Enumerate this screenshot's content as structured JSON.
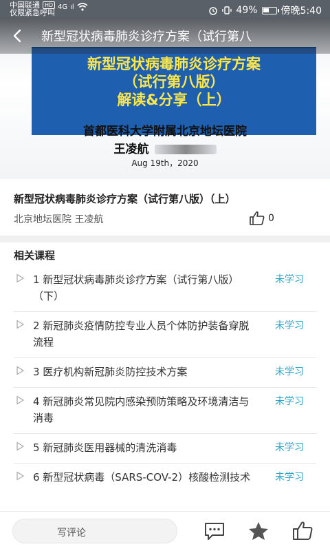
{
  "status_bar": {
    "carrier": "中国联通",
    "hd": "HD",
    "emergency": "仅限紧急呼叫",
    "network": "4G",
    "signal": "ıl",
    "battery_text": "49%",
    "battery_level": 0.49,
    "time": "傍晚5:40"
  },
  "video": {
    "title": "新型冠状病毒肺炎诊疗方案（试行第八",
    "slide_lines": [
      "新型冠状病毒肺炎诊疗方案",
      "（试行第八版）",
      "解读&分享（上）"
    ],
    "host": "首都医科大学附属北京地坛医院",
    "speaker": "王凌航",
    "date": "Aug 19th，2020"
  },
  "course": {
    "title": "新型冠状病毒肺炎诊疗方案（试行第八版）（上）",
    "author": "北京地坛医院 王凌航",
    "likes": "0"
  },
  "related": {
    "heading": "相关课程",
    "items": [
      {
        "text": "1 新型冠状病毒肺炎诊疗方案（试行第八版）（下）",
        "status": "未学习"
      },
      {
        "text": "2 新冠肺炎疫情防控专业人员个体防护装备穿脱流程",
        "status": "未学习"
      },
      {
        "text": "3 医疗机构新冠肺炎防控技术方案",
        "status": "未学习"
      },
      {
        "text": "4 新冠肺炎常见院内感染预防策略及环境清洁与消毒",
        "status": "未学习"
      },
      {
        "text": "5 新冠肺炎医用器械的清洗消毒",
        "status": "未学习"
      },
      {
        "text": "6 新型冠状病毒（SARS-COV-2）核酸检测技术",
        "status": "未学习"
      }
    ]
  },
  "bottom_bar": {
    "comment_placeholder": "写评论"
  },
  "colors": {
    "accent": "#2aa5c8",
    "slide_bg": "#1f5fb0",
    "slide_text": "#ffe74a"
  }
}
